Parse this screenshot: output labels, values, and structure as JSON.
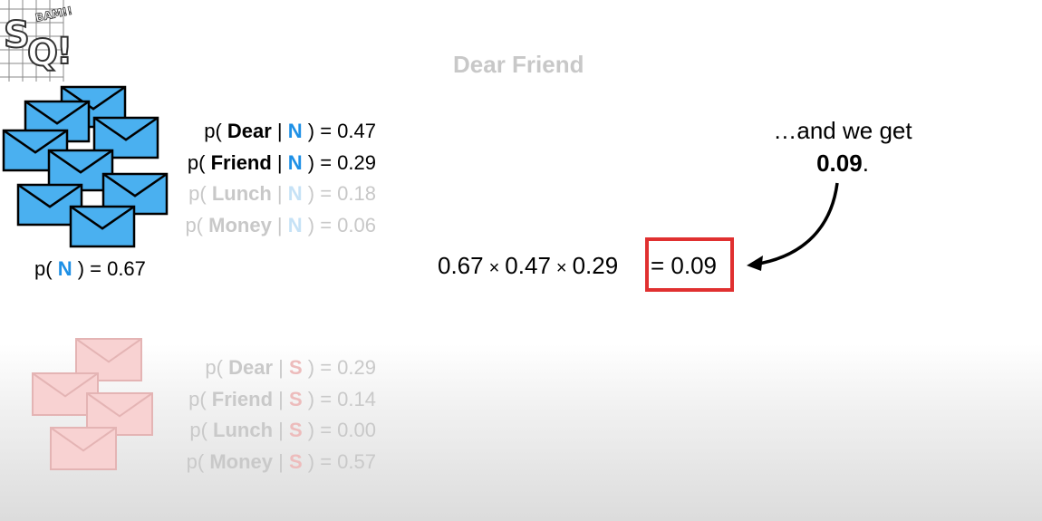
{
  "logo": {
    "text": "StatQuest",
    "burst": "Bam!!!",
    "image": "statquest-logo"
  },
  "title": "Dear Friend",
  "normal": {
    "class_label": "N",
    "prior_prefix": "p( ",
    "prior_suffix": " ) = 0.67",
    "icon": "envelope-stack-blue",
    "likelihoods": [
      {
        "word": "Dear",
        "value": "0.47"
      },
      {
        "word": "Friend",
        "value": "0.29"
      },
      {
        "word": "Lunch",
        "value": "0.18"
      },
      {
        "word": "Money",
        "value": "0.06"
      }
    ]
  },
  "spam": {
    "class_label": "S",
    "icon": "envelope-stack-red",
    "likelihoods": [
      {
        "word": "Dear",
        "value": "0.29"
      },
      {
        "word": "Friend",
        "value": "0.14"
      },
      {
        "word": "Lunch",
        "value": "0.00"
      },
      {
        "word": "Money",
        "value": "0.57"
      }
    ]
  },
  "note": {
    "line1": "…and we get",
    "value": "0.09",
    "period": "."
  },
  "calculation": {
    "terms": [
      "0.67",
      "0.47",
      "0.29"
    ],
    "times": "×",
    "result": "= 0.09"
  },
  "colors": {
    "normal": "#1e90e6",
    "spam": "#e07070",
    "highlight": "#e03030",
    "envelope_blue": "#4ab0f0",
    "envelope_red": "#f8d2d2"
  },
  "labels": {
    "p_open": "p( ",
    "bar": " | ",
    "close_eq": " ) = "
  }
}
